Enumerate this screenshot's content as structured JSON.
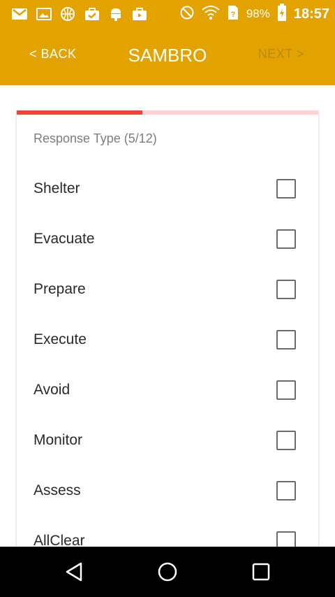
{
  "status_bar": {
    "icons_left": [
      "gmail-icon",
      "image-icon",
      "basketball-icon",
      "check-bag-icon",
      "android-icon",
      "video-bag-icon"
    ],
    "icons_right": [
      "do-not-disturb-icon",
      "wifi-icon",
      "sim-card-icon",
      "battery-charging-icon"
    ],
    "battery": "98%",
    "time": "18:57"
  },
  "app_bar": {
    "back_label": "< BACK",
    "title": "SAMBRO",
    "next_label": "NEXT >",
    "background": "#e2a200"
  },
  "card": {
    "heading": "Response Type (5/12)",
    "progress": 5,
    "progress_total": 12,
    "progress_color": "#f44336",
    "progress_track_color": "#ffd2d4",
    "options": [
      {
        "label": "Shelter",
        "checked": false
      },
      {
        "label": "Evacuate",
        "checked": false
      },
      {
        "label": "Prepare",
        "checked": false
      },
      {
        "label": "Execute",
        "checked": false
      },
      {
        "label": "Avoid",
        "checked": false
      },
      {
        "label": "Monitor",
        "checked": false
      },
      {
        "label": "Assess",
        "checked": false
      },
      {
        "label": "AllClear",
        "checked": false
      }
    ]
  },
  "nav_bar": {
    "buttons": [
      "back-triangle-icon",
      "home-circle-icon",
      "recents-square-icon"
    ]
  }
}
